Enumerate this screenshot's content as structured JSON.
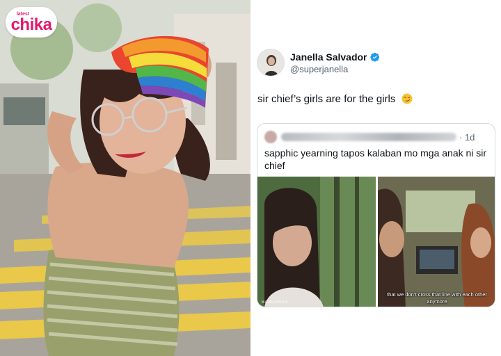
{
  "logo": {
    "small": "latest",
    "main": "chika"
  },
  "tweet": {
    "display_name": "Janella Salvador",
    "handle": "@superjanella",
    "text": "sir chief’s girls are for the girls",
    "verified_color": "#1d9bf0",
    "emoji": "smirk-face"
  },
  "quote": {
    "time": "· 1d",
    "text": "sapphic yearning tapos kalaban mo mga anak ni sir chief",
    "media_left_watermark": "BANGUNAN",
    "media_right_subtitle": "that we don’t cross that line with each other anymore"
  },
  "colors": {
    "brand": "#e4196b",
    "text": "#0f1419",
    "muted": "#536471",
    "border": "#cfd9de"
  }
}
